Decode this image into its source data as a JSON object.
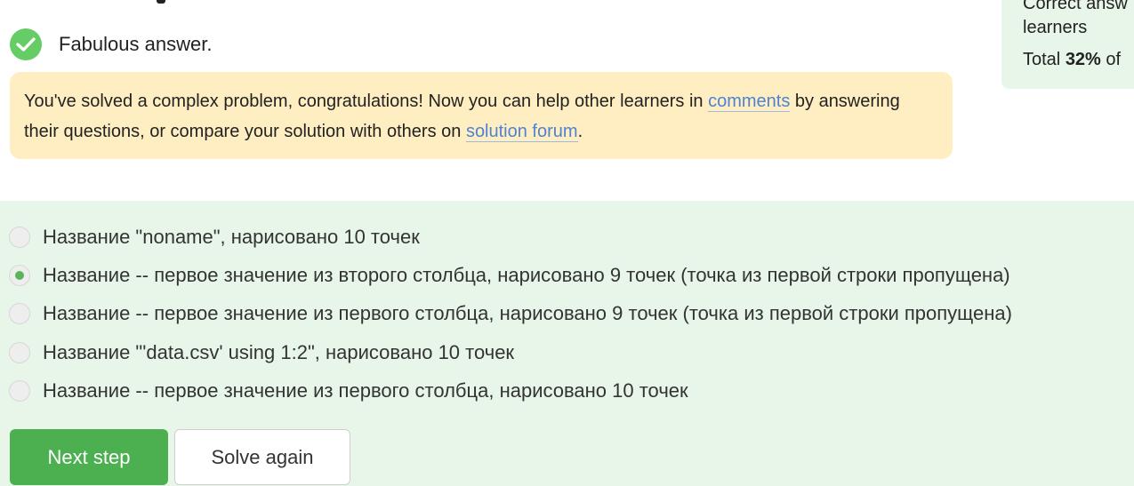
{
  "stats": {
    "line1": "Correct answ",
    "line2": "learners",
    "total_prefix": "Total ",
    "total_percent": "32%",
    "total_suffix": " of"
  },
  "result": {
    "icon": "checkmark-icon",
    "text": "Fabulous answer."
  },
  "note": {
    "text_before_comments": "You've solved a complex problem, congratulations! Now you can help other learners in ",
    "comments_link": "comments",
    "text_after_comments": " by answering their questions, or compare your solution with others on ",
    "forum_link": "solution forum",
    "text_end": "."
  },
  "options": [
    {
      "label": "Название \"noname\", нарисовано 10 точек",
      "selected": false
    },
    {
      "label": "Название -- первое значение из второго столбца, нарисовано 9 точек (точка из первой строки пропущена)",
      "selected": true
    },
    {
      "label": "Название -- первое значение из первого столбца, нарисовано 9 точек (точка из первой строки пропущена)",
      "selected": false
    },
    {
      "label": "Название \"'data.csv' using 1:2\", нарисовано 10 точек",
      "selected": false
    },
    {
      "label": "Название -- первое значение из первого столбца, нарисовано 10 точек",
      "selected": false
    }
  ],
  "buttons": {
    "next": "Next step",
    "again": "Solve again"
  },
  "colors": {
    "accent_green": "#4caf50",
    "check_green": "#66cc66",
    "note_bg": "#ffeec2",
    "quiz_bg": "#e8f6e9",
    "link": "#4f82d3"
  }
}
